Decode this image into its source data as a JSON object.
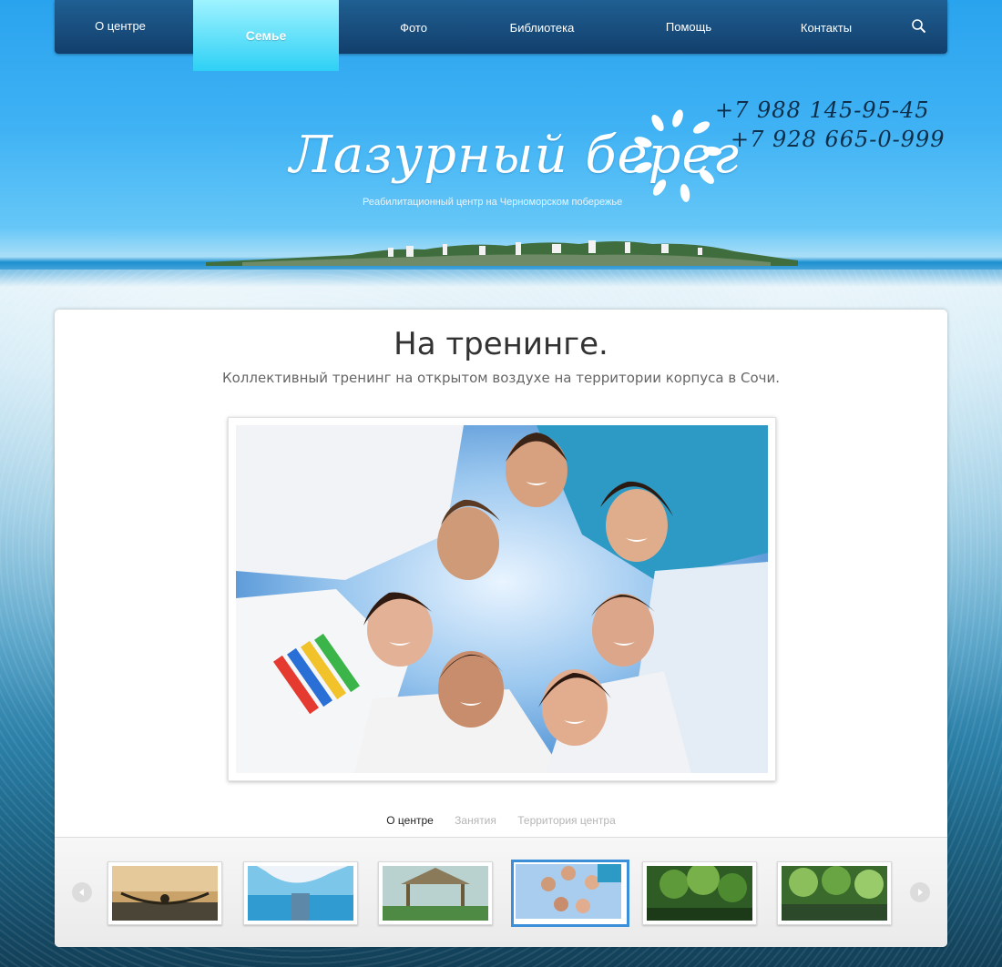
{
  "nav": {
    "items": [
      {
        "label": "О центре"
      },
      {
        "label": "Семье"
      },
      {
        "label": "Фото"
      },
      {
        "label": "Библиотека"
      },
      {
        "label": "Помощь"
      },
      {
        "label": "Контакты"
      }
    ],
    "active_index": 1,
    "search_icon": "search-icon"
  },
  "header": {
    "logo_text": "Лазурный берег",
    "tagline": "Реабилитационный центр на Черноморском побережье",
    "phones": [
      "+7 988 145-95-45",
      "+7 928 665-0-999"
    ]
  },
  "content": {
    "title": "На тренинге.",
    "subtitle": "Коллективный тренинг на открытом воздухе на территории корпуса в Сочи.",
    "tabs": [
      {
        "label": "О центре"
      },
      {
        "label": "Занятия"
      },
      {
        "label": "Территория центра"
      }
    ],
    "active_tab": 0,
    "thumbnails_count": 6,
    "active_thumbnail": 3
  },
  "colors": {
    "nav_bg": "#163f6b",
    "nav_active": "#2ed0f5",
    "thumb_active_border": "#3a8fd8",
    "title_color": "#333333"
  }
}
